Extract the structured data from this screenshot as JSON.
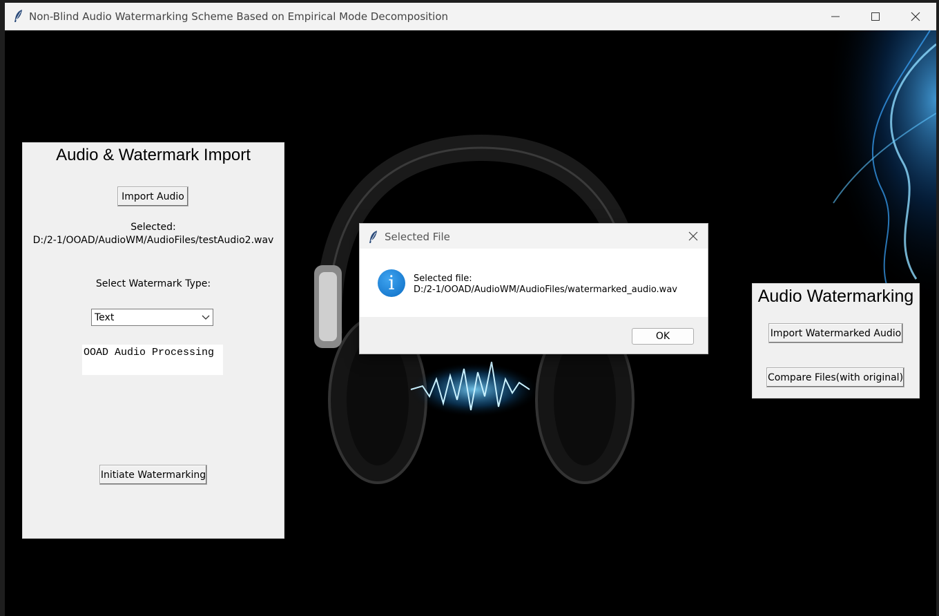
{
  "window": {
    "title": "Non-Blind Audio Watermarking Scheme Based on Empirical Mode Decomposition"
  },
  "left_panel": {
    "title": "Audio & Watermark Import",
    "import_button": "Import Audio",
    "selected_label": "Selected:",
    "selected_path": "D:/2-1/OOAD/AudioWM/AudioFiles/testAudio2.wav",
    "watermark_type_label": "Select Watermark Type:",
    "watermark_type_value": "Text",
    "watermark_text": "OOAD Audio Processing",
    "initiate_button": "Initiate Watermarking"
  },
  "right_panel": {
    "title": "Audio Watermarking",
    "import_watermarked_button": "Import Watermarked Audio",
    "compare_button": "Compare Files(with original)"
  },
  "dialog": {
    "title": "Selected File",
    "message_line1": "Selected file:",
    "message_line2": "D:/2-1/OOAD/AudioWM/AudioFiles/watermarked_audio.wav",
    "ok_button": "OK"
  },
  "icons": {
    "app": "feather-icon",
    "info": "info-icon"
  }
}
